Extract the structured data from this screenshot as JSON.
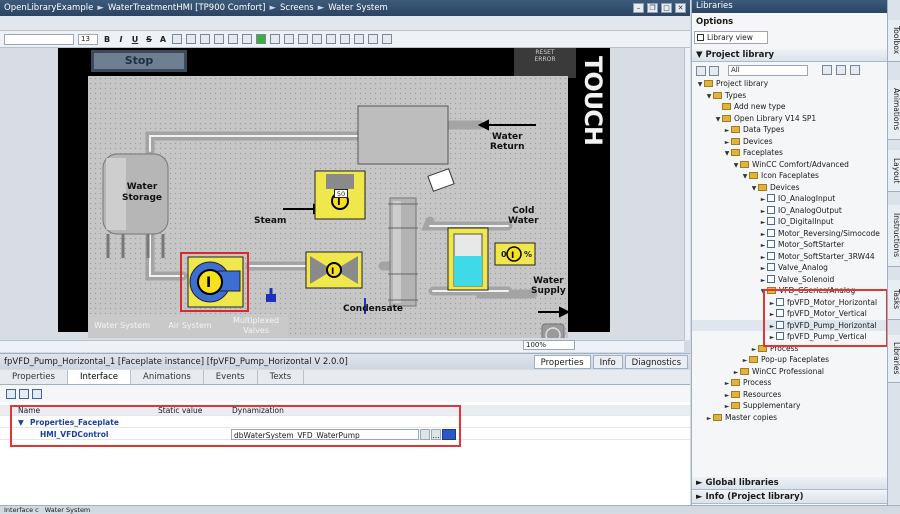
{
  "breadcrumb": [
    "OpenLibraryExample",
    "WaterTreatmentHMI [TP900 Comfort]",
    "Screens",
    "Water System"
  ],
  "toolbar": {
    "font_size": "13"
  },
  "hmi": {
    "stop_label": "Stop",
    "reset_label": "RESET\nERROR",
    "brand": "TOUCH",
    "water_storage": "Water\nStorage",
    "steam": "Steam",
    "water_return": "Water\nReturn",
    "cold_water": "Cold\nWater",
    "water_supply": "Water\nSupply",
    "condensate": "Condensate",
    "valve_value": "50",
    "tank_percent": "%",
    "tank_value": "0",
    "nav": [
      "Water System",
      "Air System",
      "Multiplexed\nValves"
    ]
  },
  "zoom": "100%",
  "properties": {
    "title": "fpVFD_Pump_Horizontal_1 [Faceplate instance] [fpVFD_Pump_Horizontal V 2.0.0]",
    "main_tabs": [
      "Properties",
      "Info",
      "Diagnostics"
    ],
    "tabs": [
      "Properties",
      "Interface",
      "Animations",
      "Events",
      "Texts"
    ],
    "active_tab": "Interface",
    "columns": [
      "Name",
      "Static value",
      "Dynamization"
    ],
    "group": "Properties_Faceplate",
    "row_name": "HMI_VFDControl",
    "row_value": "dbWaterSystem_VFD_WaterPump"
  },
  "library": {
    "title": "Libraries",
    "options": "Options",
    "library_view": "Library view",
    "project_library": "Project library",
    "filter": "All",
    "tree": [
      {
        "label": "Project library",
        "level": 0,
        "open": true
      },
      {
        "label": "Types",
        "level": 1,
        "open": true
      },
      {
        "label": "Add new type",
        "level": 2,
        "leaf": true,
        "icon": "add"
      },
      {
        "label": "Open Library V14 SP1",
        "level": 2,
        "open": true
      },
      {
        "label": "Data Types",
        "level": 3
      },
      {
        "label": "Devices",
        "level": 3
      },
      {
        "label": "Faceplates",
        "level": 3,
        "open": true
      },
      {
        "label": "WinCC Comfort/Advanced",
        "level": 4,
        "open": true
      },
      {
        "label": "Icon Faceplates",
        "level": 5,
        "open": true
      },
      {
        "label": "Devices",
        "level": 6,
        "open": true
      },
      {
        "label": "IO_AnalogInput",
        "level": 7,
        "fp": true
      },
      {
        "label": "IO_AnalogOutput",
        "level": 7,
        "fp": true
      },
      {
        "label": "IO_DigitalInput",
        "level": 7,
        "fp": true
      },
      {
        "label": "Motor_Reversing/Simocode",
        "level": 7,
        "fp": true
      },
      {
        "label": "Motor_SoftStarter",
        "level": 7,
        "fp": true
      },
      {
        "label": "Motor_SoftStarter_3RW44",
        "level": 7,
        "fp": true
      },
      {
        "label": "Valve_Analog",
        "level": 7,
        "fp": true
      },
      {
        "label": "Valve_Solenoid",
        "level": 7,
        "fp": true
      },
      {
        "label": "VFD_GSeries/Analog",
        "level": 7,
        "open": true
      },
      {
        "label": "fpVFD_Motor_Horizontal",
        "level": 8,
        "fp": true
      },
      {
        "label": "fpVFD_Motor_Vertical",
        "level": 8,
        "fp": true
      },
      {
        "label": "fpVFD_Pump_Horizontal",
        "level": 8,
        "fp": true,
        "selected": true
      },
      {
        "label": "fpVFD_Pump_Vertical",
        "level": 8,
        "fp": true
      },
      {
        "label": "Process",
        "level": 6
      },
      {
        "label": "Pop-up Faceplates",
        "level": 5
      },
      {
        "label": "WinCC Professional",
        "level": 4
      },
      {
        "label": "Process",
        "level": 3
      },
      {
        "label": "Resources",
        "level": 3
      },
      {
        "label": "Supplementary",
        "level": 3
      },
      {
        "label": "Master copies",
        "level": 1
      }
    ],
    "global_libraries": "Global libraries",
    "info": "Info (Project library)"
  },
  "side_tabs": [
    "Toolbox",
    "Animations",
    "Layout",
    "Instructions",
    "Tasks",
    "Libraries"
  ],
  "statusbar": [
    "Interface c",
    "Water System"
  ]
}
